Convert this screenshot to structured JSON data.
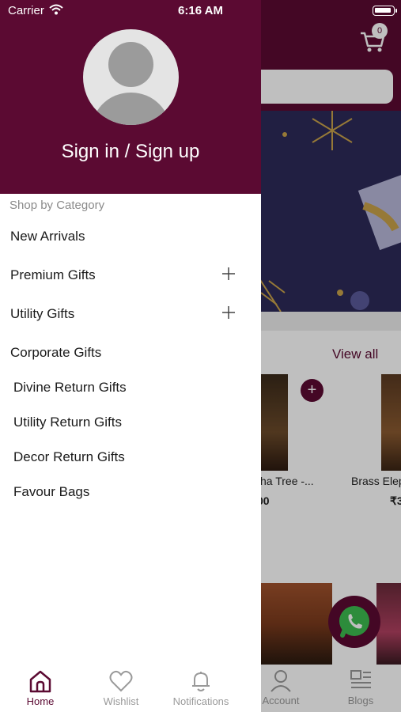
{
  "status_bar": {
    "carrier": "Carrier",
    "time": "6:16 AM"
  },
  "drawer": {
    "signin_label": "Sign in / Sign up",
    "section_label": "Shop by Category",
    "items": [
      {
        "label": "New Arrivals",
        "expandable": false
      },
      {
        "label": "Premium Gifts",
        "expandable": true
      },
      {
        "label": "Utility Gifts",
        "expandable": true
      },
      {
        "label": "Corporate Gifts",
        "expandable": false
      }
    ],
    "sub_items": [
      "Divine Return Gifts",
      "Utility Return Gifts",
      "Decor Return Gifts",
      "Favour Bags"
    ]
  },
  "background": {
    "cart_count": "0",
    "view_all": "View all",
    "products": [
      {
        "name": "sha Tree -...",
        "price": "00"
      },
      {
        "name": "Brass Elep",
        "price": "₹3"
      }
    ],
    "tabs": [
      "Account",
      "Blogs"
    ]
  },
  "tabbar": {
    "tabs": [
      {
        "label": "Home",
        "icon": "home-icon",
        "active": true
      },
      {
        "label": "Wishlist",
        "icon": "heart-icon",
        "active": false
      },
      {
        "label": "Notifications",
        "icon": "bell-icon",
        "active": false
      }
    ]
  },
  "colors": {
    "brand": "#5b0a32",
    "background": "#ffffff"
  }
}
